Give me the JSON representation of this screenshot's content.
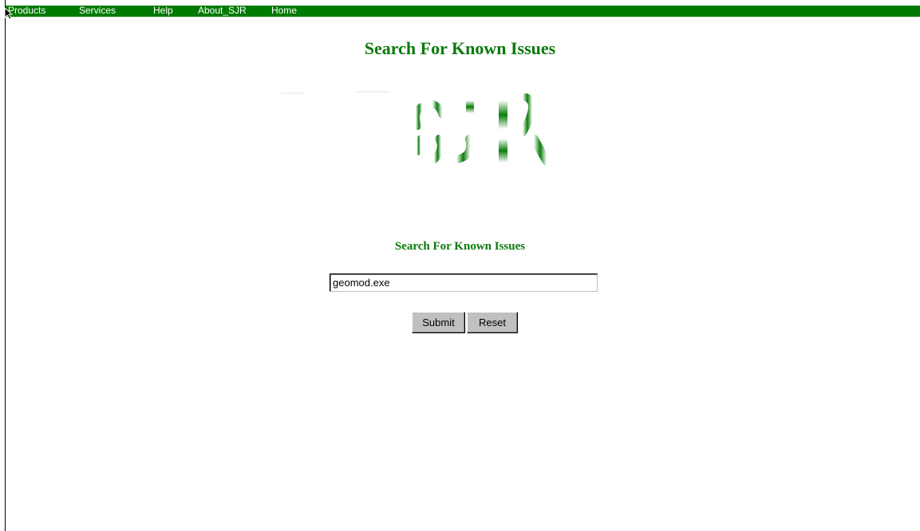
{
  "nav": {
    "items": [
      {
        "label": "Products"
      },
      {
        "label": "Services"
      },
      {
        "label": "Help"
      },
      {
        "label": "About_SJR"
      },
      {
        "label": "Home"
      }
    ]
  },
  "page": {
    "title": "Search For Known Issues"
  },
  "logo": {
    "text": "SJR",
    "icon": "sjr-logo"
  },
  "search": {
    "heading": "Search For Known Issues",
    "value": "geomod.exe",
    "submit_label": "Submit",
    "reset_label": "Reset"
  },
  "colors": {
    "nav_bg": "#007a00",
    "accent": "#0b7a0b",
    "button_bg": "#c0c0c0"
  }
}
